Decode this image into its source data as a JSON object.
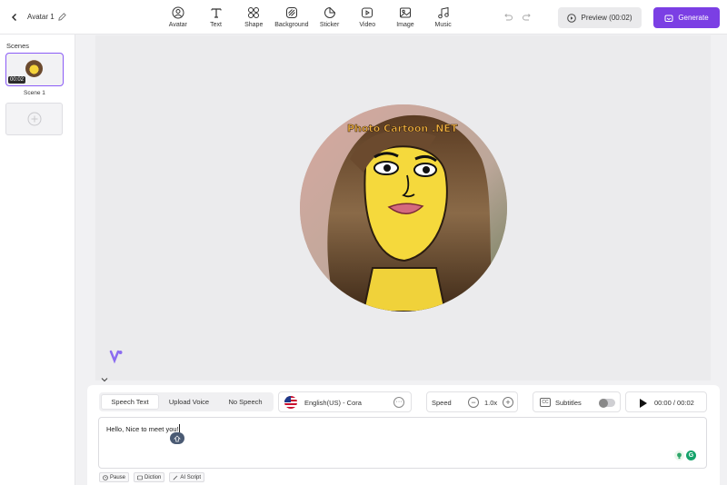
{
  "header": {
    "title": "Avatar 1",
    "tools": [
      {
        "label": "Avatar",
        "icon": "avatar-icon"
      },
      {
        "label": "Text",
        "icon": "text-icon"
      },
      {
        "label": "Shape",
        "icon": "shape-icon"
      },
      {
        "label": "Background",
        "icon": "background-icon"
      },
      {
        "label": "Sticker",
        "icon": "sticker-icon"
      },
      {
        "label": "Video",
        "icon": "video-icon"
      },
      {
        "label": "Image",
        "icon": "image-icon"
      },
      {
        "label": "Music",
        "icon": "music-icon"
      }
    ],
    "preview_label": "Preview (00:02)",
    "generate_label": "Generate",
    "accent_color": "#7b3fe4"
  },
  "sidebar": {
    "title": "Scenes",
    "scenes": [
      {
        "name": "Scene 1",
        "duration": "00:02",
        "selected": true
      }
    ]
  },
  "canvas": {
    "avatar_caption": "Photo Cartoon .NET"
  },
  "panel": {
    "tabs": [
      {
        "label": "Speech Text",
        "active": true
      },
      {
        "label": "Upload Voice",
        "active": false
      },
      {
        "label": "No Speech",
        "active": false
      }
    ],
    "voice": "English(US) - Cora",
    "speed_label": "Speed",
    "speed_value": "1.0x",
    "subtitles_label": "Subtitles",
    "subtitles_on": false,
    "playback_time": "00:00 / 00:02",
    "speech_text": "Hello, Nice to meet you!",
    "chips": [
      {
        "label": "Pause",
        "icon": "clock-icon"
      },
      {
        "label": "Diction",
        "icon": "diction-icon"
      },
      {
        "label": "AI Script",
        "icon": "magic-wand-icon"
      }
    ]
  }
}
